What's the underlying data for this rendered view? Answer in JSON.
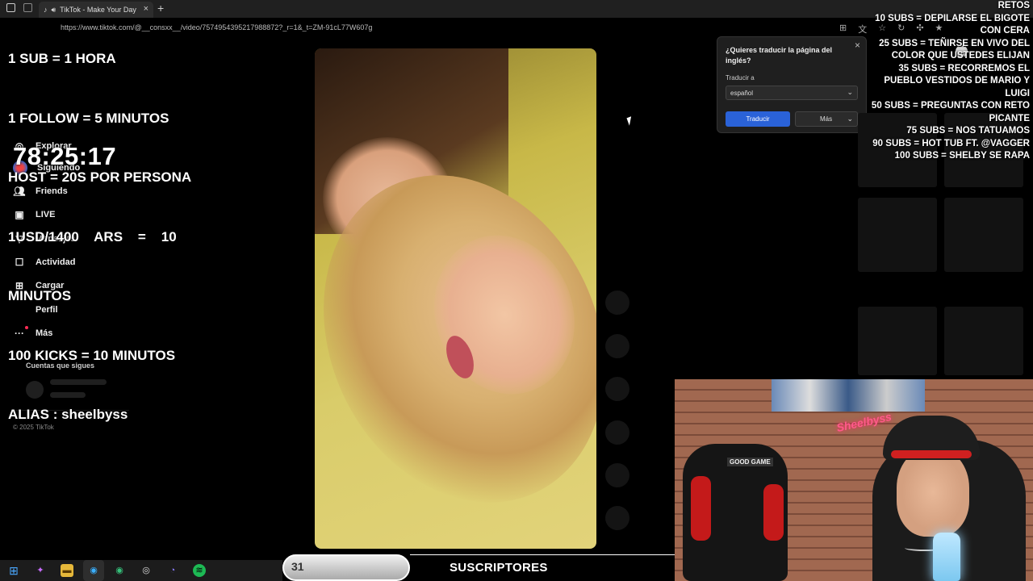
{
  "browser": {
    "tab_title": "TikTok - Make Your Day",
    "tab_close": "×",
    "new_tab": "+",
    "url": "https://www.tiktok.com/@__consxx__/video/7574954395217988872?_r=1&_t=ZM-91cL77W607g"
  },
  "stream_overlay": {
    "rules": [
      "1 SUB = 1 HORA",
      "1 FOLLOW = 5 MINUTOS",
      "HOST = 20S POR PERSONA",
      "1USD/1400    ARS    =    10",
      "MINUTOS",
      "100 KICKS = 10 MINUTOS",
      "ALIAS : sheelbyss"
    ],
    "timer": "78:25:17",
    "retos_title": "RETOS",
    "retos": [
      "10 SUBS = DEPILARSE EL BIGOTE",
      "CON CERA",
      "25 SUBS = TEÑIRSE EN VIVO DEL",
      "COLOR QUE USTEDES ELIJAN",
      "35 SUBS = RECORREMOS EL",
      "PUEBLO VESTIDOS DE MARIO Y",
      "LUIGI",
      "50 SUBS = PREGUNTAS CON RETO",
      "PICANTE",
      "75 SUBS = NOS TATUAMOS",
      "90 SUBS  = HOT TUB FT. @VAGGER",
      "100 SUBS = SHELBY SE RAPA"
    ],
    "sub_count": "31",
    "sub_label": "SUSCRIPTORES"
  },
  "tiktok_nav": {
    "items": [
      {
        "label": "Explorar",
        "icon": "compass-icon"
      },
      {
        "label": "Siguiendo",
        "icon": "following-avatar"
      },
      {
        "label": "Friends",
        "icon": "friends-icon"
      },
      {
        "label": "LIVE",
        "icon": "live-icon"
      },
      {
        "label": "Mensajes",
        "icon": "messages-icon"
      },
      {
        "label": "Actividad",
        "icon": "activity-icon"
      },
      {
        "label": "Cargar",
        "icon": "upload-icon"
      },
      {
        "label": "Perfil",
        "icon": "profile-icon"
      },
      {
        "label": "Más",
        "icon": "more-icon"
      }
    ],
    "cuentas_label": "Cuentas que sigues",
    "copyright": "© 2025 TikTok"
  },
  "translate_popup": {
    "title": "¿Quieres traducir la página del inglés?",
    "close": "×",
    "target_label": "Traducir a",
    "target_value": "español",
    "translate_button": "Traducir",
    "more_button": "Más"
  },
  "webcam": {
    "neon_sign": "Sheelbyss",
    "chair_badge": "GOOD GAME"
  },
  "colors": {
    "accent_blue": "#2a62d8",
    "tiktok_pink": "#fe2c55"
  }
}
